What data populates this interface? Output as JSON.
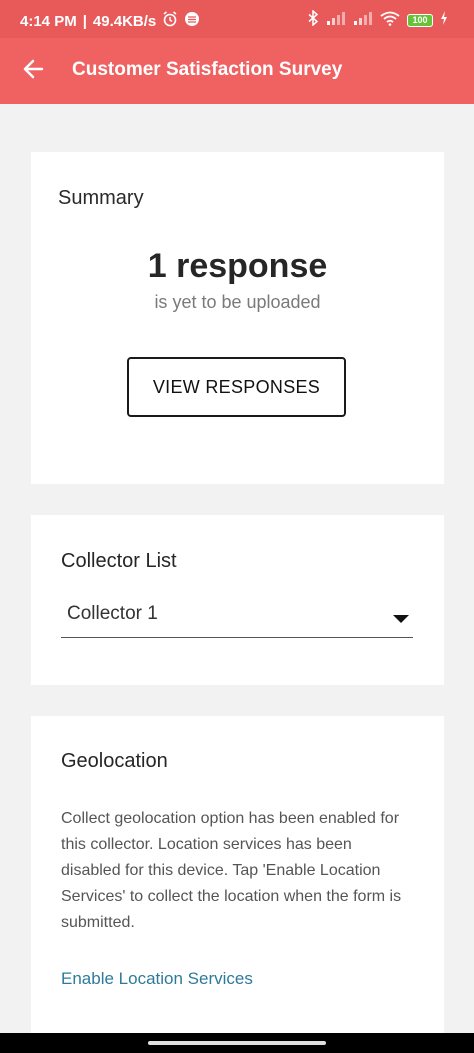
{
  "status_bar": {
    "time": "4:14 PM",
    "separator": "|",
    "network_speed": "49.4KB/s",
    "battery_level": "100",
    "icons": [
      "alarm-icon",
      "app-notification-icon",
      "bluetooth-icon",
      "signal-icon",
      "signal-icon",
      "wifi-icon",
      "battery-icon",
      "charging-icon"
    ]
  },
  "app_bar": {
    "title": "Customer Satisfaction Survey",
    "back_icon": "arrow-left-icon",
    "color": "#f06262"
  },
  "summary": {
    "title": "Summary",
    "response_count": "1 response",
    "response_subtext": "is yet to be uploaded",
    "view_button_label": "VIEW RESPONSES"
  },
  "collector": {
    "title": "Collector List",
    "selected": "Collector 1"
  },
  "geolocation": {
    "title": "Geolocation",
    "description": "Collect geolocation option has been enabled for this collector. Location services has been disabled for this device. Tap 'Enable Location Services' to collect the location when the form is submitted.",
    "link_label": "Enable Location Services",
    "link_color": "#2f7a9a"
  }
}
